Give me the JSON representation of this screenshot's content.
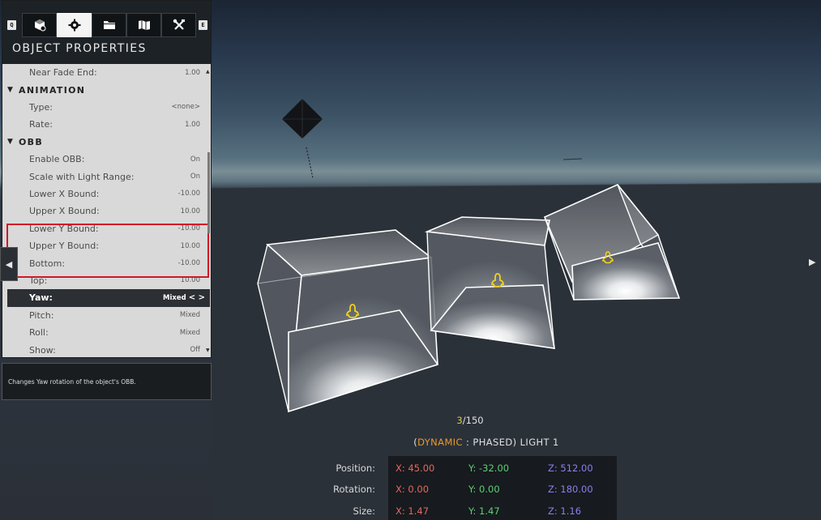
{
  "panel": {
    "key_left": "Q",
    "key_right": "E",
    "tabs": [
      {
        "icon": "objects-icon",
        "active": false
      },
      {
        "icon": "gear-icon",
        "active": true
      },
      {
        "icon": "folder-icon",
        "active": false
      },
      {
        "icon": "map-icon",
        "active": false
      },
      {
        "icon": "tools-icon",
        "active": false
      }
    ],
    "title": "OBJECT PROPERTIES",
    "rows": [
      {
        "label": "Near Fade End:",
        "value": "1.00"
      },
      {
        "label": "ANIMATION",
        "section": true
      },
      {
        "label": "Type:",
        "value": "<none>"
      },
      {
        "label": "Rate:",
        "value": "1.00"
      },
      {
        "label": "OBB",
        "section": true
      },
      {
        "label": "Enable OBB:",
        "value": "On"
      },
      {
        "label": "Scale with Light Range:",
        "value": "On"
      },
      {
        "label": "Lower X Bound:",
        "value": "-10.00"
      },
      {
        "label": "Upper X Bound:",
        "value": "10.00"
      },
      {
        "label": "Lower Y Bound:",
        "value": "-10.00"
      },
      {
        "label": "Upper Y Bound:",
        "value": "10.00"
      },
      {
        "label": "Bottom:",
        "value": "-10.00"
      },
      {
        "label": "Top:",
        "value": "10.00"
      },
      {
        "label": "Yaw:",
        "value": "Mixed",
        "arrows": "< >",
        "selected": true
      },
      {
        "label": "Pitch:",
        "value": "Mixed"
      },
      {
        "label": "Roll:",
        "value": "Mixed"
      },
      {
        "label": "Show:",
        "value": "Off"
      }
    ]
  },
  "description": "Changes Yaw rotation of the object's OBB.",
  "navigation": {
    "left_arrow": "◀",
    "right_arrow": "▶"
  },
  "selection": {
    "current": "3",
    "total": "/150"
  },
  "light_name": {
    "open": "(",
    "type": "DYNAMIC",
    "rest": " : PHASED) LIGHT 1"
  },
  "transform": {
    "labels": [
      "Position:",
      "Rotation:",
      "Size:"
    ],
    "position": {
      "x": "X: 45.00",
      "y": "Y: -32.00",
      "z": "Z: 512.00"
    },
    "rotation": {
      "x": "X: 0.00",
      "y": "Y: 0.00",
      "z": "Z: 180.00"
    },
    "size": {
      "x": "X: 1.47",
      "y": "Y: 1.47",
      "z": "Z: 1.16"
    }
  },
  "colors": {
    "highlight": "#d0172a",
    "x_axis": "#e06a62",
    "y_axis": "#5bd174",
    "z_axis": "#8a7ff0",
    "counter_accent": "#e1c74a",
    "dynamic_accent": "#e89a2a",
    "light_icon": "#f2d21c"
  }
}
